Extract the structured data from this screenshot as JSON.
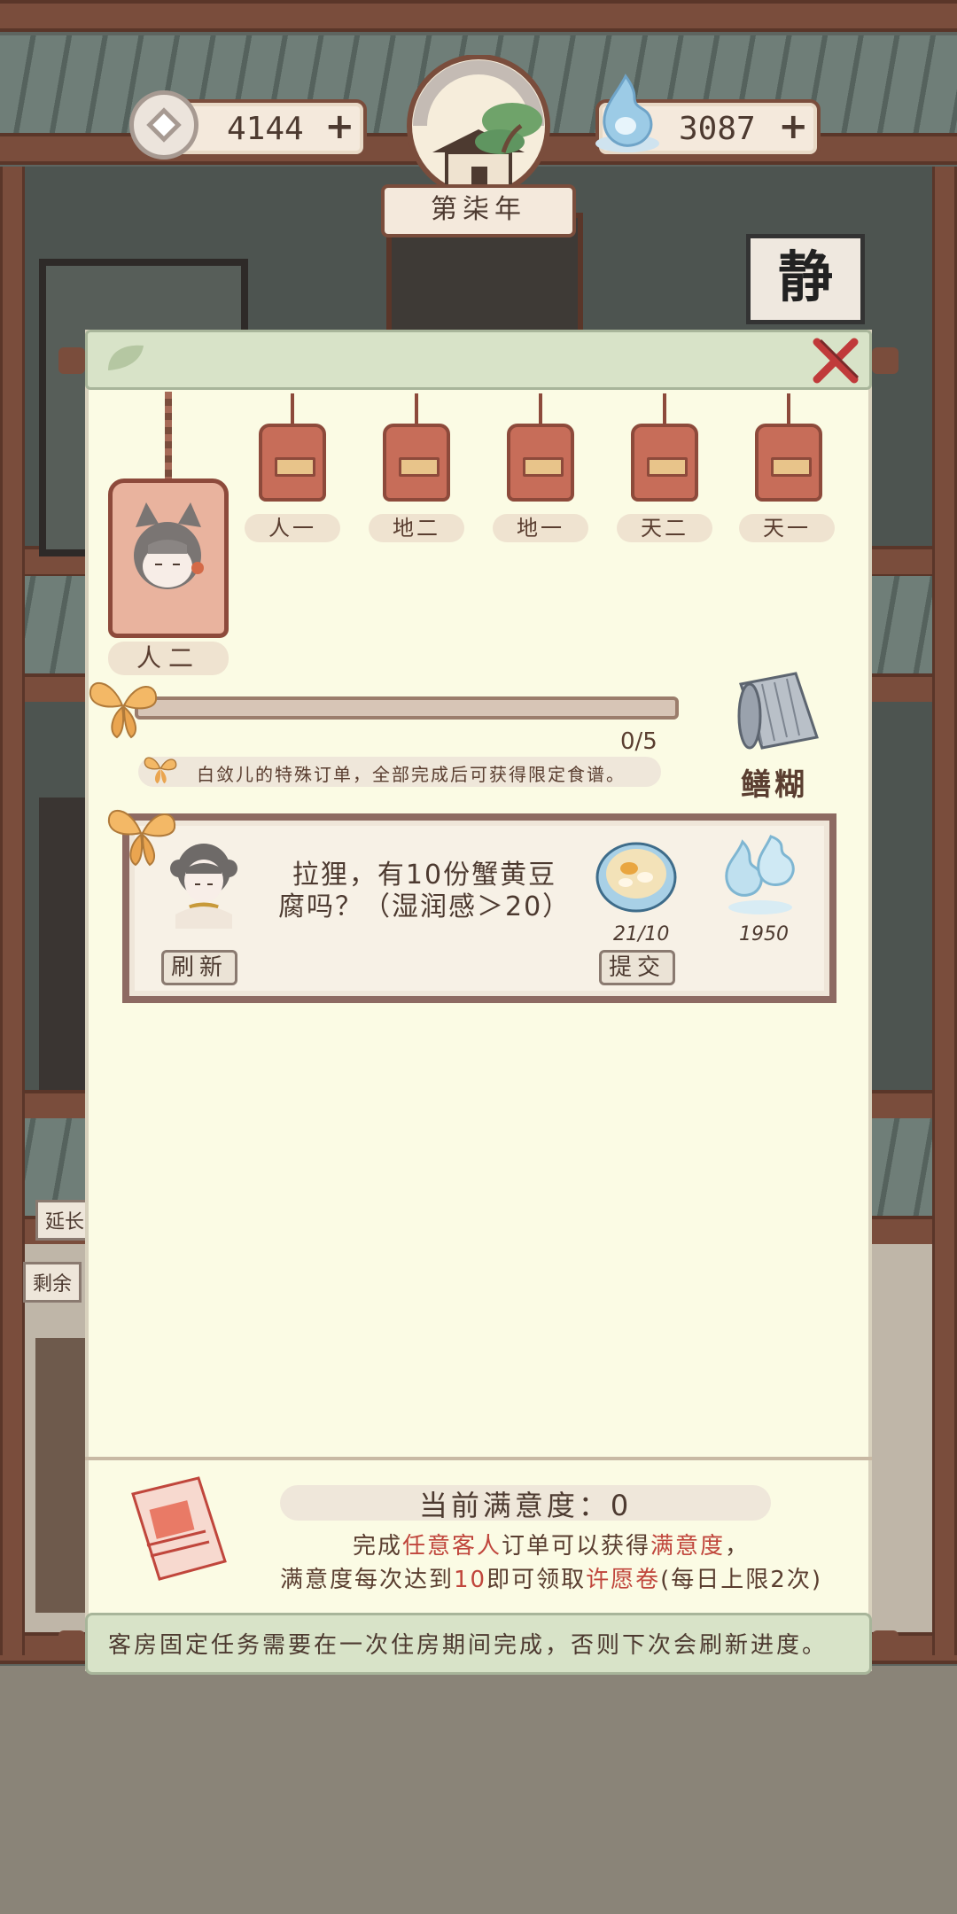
{
  "hud": {
    "coins": "4144",
    "spirit": "3087",
    "year": "第柒年",
    "sign": "静"
  },
  "side_tags": {
    "extend": "延长",
    "remaining": "剩余"
  },
  "ranks": {
    "current": "人二",
    "tabs": [
      "人一",
      "地二",
      "地一",
      "天二",
      "天一"
    ]
  },
  "progress": {
    "text": "0/5",
    "value": 0,
    "max": 5
  },
  "hint": "白敛儿的特殊订单，全部完成后可获得限定食谱。",
  "reward": {
    "name": "鳝糊",
    "icon": "recipe-scroll-icon"
  },
  "order": {
    "text": "拉狸，有10份蟹黄豆腐吗？（湿润感＞20）",
    "refresh_label": "刷新",
    "submit_label": "提交",
    "dish_qty": "21/10",
    "spirit_reward": "1950"
  },
  "satisfaction": {
    "title": "当前满意度：0",
    "desc_line1_a": "完成",
    "desc_line1_red1": "任意客人",
    "desc_line1_b": "订单可以获得",
    "desc_line1_red2": "满意度",
    "desc_line1_c": "，",
    "desc_line2_a": "满意度每次达到",
    "desc_line2_red1": "10",
    "desc_line2_b": "即可领取",
    "desc_line2_red2": "许愿卷",
    "desc_line2_c": "(每日上限2次)"
  },
  "footer_note": "客房固定任务需要在一次住房期间完成，否则下次会刷新进度。",
  "colors": {
    "panel_bg": "#fbfbe4",
    "scroll_green": "#d8e3c8",
    "tag_red": "#c76d59",
    "accent_red": "#c0463c",
    "wood": "#7a4d3c"
  }
}
